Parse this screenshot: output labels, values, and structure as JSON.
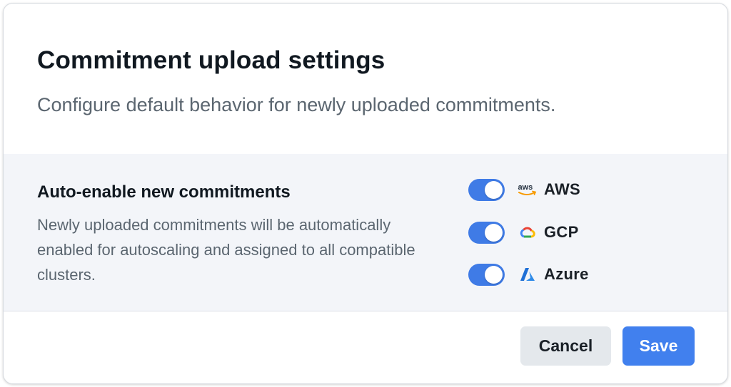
{
  "dialog": {
    "title": "Commitment upload settings",
    "subtitle": "Configure default behavior for newly uploaded commitments."
  },
  "setting": {
    "title": "Auto-enable new commitments",
    "description": "Newly uploaded commitments will be automatically enabled for autoscaling and assigned to all compatible clusters."
  },
  "providers": [
    {
      "name": "AWS",
      "icon": "aws-logo-icon",
      "enabled": true
    },
    {
      "name": "GCP",
      "icon": "gcp-logo-icon",
      "enabled": true
    },
    {
      "name": "Azure",
      "icon": "azure-logo-icon",
      "enabled": true
    }
  ],
  "actions": {
    "cancel_label": "Cancel",
    "save_label": "Save"
  },
  "colors": {
    "accent": "#4180ee",
    "toggle_on": "#3f7be6",
    "panel_bg": "#f3f5f9",
    "aws_orange": "#f79a00",
    "azure_blue": "#1f6fd6"
  }
}
